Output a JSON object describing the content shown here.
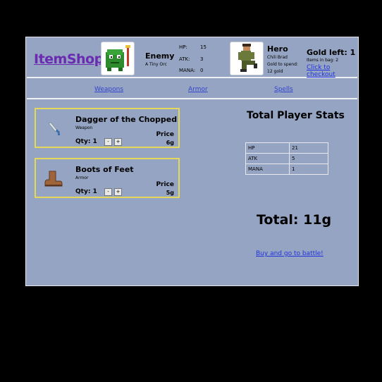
{
  "logo": "ItemShop",
  "enemy": {
    "name": "Enemy",
    "subtitle": "A Tiny Orc",
    "stats": [
      {
        "label": "HP:",
        "value": "15"
      },
      {
        "label": "ATK:",
        "value": "3"
      },
      {
        "label": "MANA:",
        "value": "0"
      }
    ]
  },
  "hero": {
    "name": "Hero",
    "player": "Chili Brad",
    "gold_label": "Gold to spend:",
    "gold": "12 gold"
  },
  "summary": {
    "gold_left": "Gold left: 1",
    "items_in_bag": "Items in bag: 2",
    "checkout": "Click to checkout"
  },
  "nav": [
    "Weapons",
    "Armor",
    "Spells"
  ],
  "cart": [
    {
      "name": "Dagger of the Chopped",
      "type": "Weapon",
      "qty": "Qty: 1",
      "price_label": "Price",
      "price": "6g",
      "minus": "-",
      "plus": "+",
      "icon": "dagger-icon"
    },
    {
      "name": "Boots of Feet",
      "type": "Armor",
      "qty": "Qty: 1",
      "price_label": "Price",
      "price": "5g",
      "minus": "-",
      "plus": "+",
      "icon": "boot-icon"
    }
  ],
  "player_stats": {
    "title": "Total Player Stats",
    "rows": [
      {
        "k": "HP",
        "v": "21"
      },
      {
        "k": "ATK",
        "v": "5"
      },
      {
        "k": "MANA",
        "v": "1"
      }
    ]
  },
  "total": "Total: 11g",
  "battle": "Buy and go to battle!"
}
